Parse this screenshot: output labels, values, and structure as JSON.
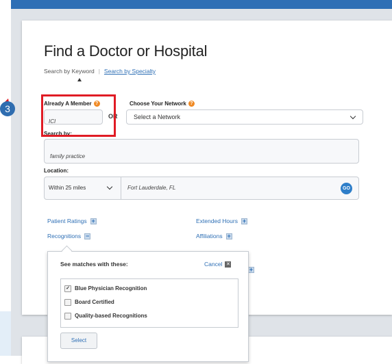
{
  "page": {
    "title": "Find a Doctor or Hospital",
    "search_by_keyword": "Search by Keyword",
    "search_by_specialty": "Search by Specialty"
  },
  "member": {
    "label": "Already A Member",
    "value": "ICI"
  },
  "or_text": "OR",
  "network": {
    "label": "Choose Your Network",
    "selected": "Select a Network"
  },
  "search": {
    "label": "Search by:",
    "value": "family practice"
  },
  "location": {
    "label": "Location:",
    "radius": "Within 25 miles",
    "value": "Fort Lauderdale, FL",
    "go": "GO"
  },
  "options": {
    "patient_ratings": "Patient Ratings",
    "extended_hours": "Extended Hours",
    "recognitions": "Recognitions",
    "affiliations": "Affiliations"
  },
  "popup": {
    "heading": "See matches with these:",
    "cancel": "Cancel",
    "items": [
      {
        "label": "Blue Physician Recognition",
        "checked": true
      },
      {
        "label": "Board Certified",
        "checked": false
      },
      {
        "label": "Quality-based Recognitions",
        "checked": false
      }
    ],
    "select": "Select"
  },
  "step_marker": "3",
  "colors": {
    "accent": "#2e6fb5",
    "highlight": "#e01b24",
    "help_icon": "#f08a24",
    "step_marker": "#2f6db0"
  }
}
